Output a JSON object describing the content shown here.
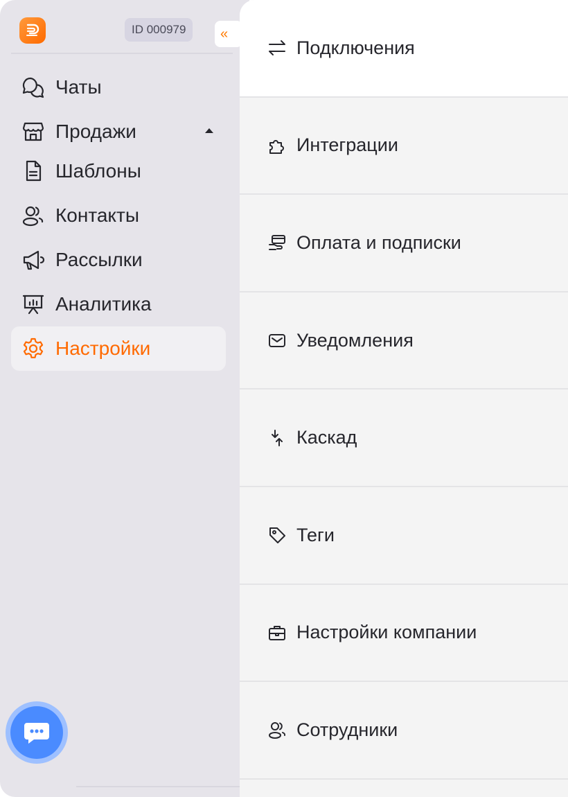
{
  "sidebar": {
    "id_badge": "ID 000979",
    "collapse_label": "«",
    "items": [
      {
        "label": "Чаты",
        "icon": "chats-icon"
      },
      {
        "label": "Продажи",
        "icon": "store-icon"
      },
      {
        "label": "Шаблоны",
        "icon": "document-icon"
      },
      {
        "label": "Контакты",
        "icon": "users-icon"
      },
      {
        "label": "Рассылки",
        "icon": "megaphone-icon"
      },
      {
        "label": "Аналитика",
        "icon": "presentation-chart-icon"
      },
      {
        "label": "Настройки",
        "icon": "gear-icon",
        "active": true
      }
    ]
  },
  "settings": {
    "items": [
      {
        "label": "Подключения",
        "icon": "arrows-exchange-icon"
      },
      {
        "label": "Интеграции",
        "icon": "puzzle-icon"
      },
      {
        "label": "Оплата и подписки",
        "icon": "payment-icon"
      },
      {
        "label": "Уведомления",
        "icon": "mail-icon"
      },
      {
        "label": "Каскад",
        "icon": "cascade-arrows-icon"
      },
      {
        "label": "Теги",
        "icon": "tag-icon"
      },
      {
        "label": "Настройки компании",
        "icon": "briefcase-icon"
      },
      {
        "label": "Сотрудники",
        "icon": "users-icon"
      }
    ]
  },
  "colors": {
    "accent": "#ff6a00",
    "sidebar_bg": "#e6e4ea",
    "panel_bg": "#f4f4f4",
    "chat_button": "#4a8bff"
  }
}
